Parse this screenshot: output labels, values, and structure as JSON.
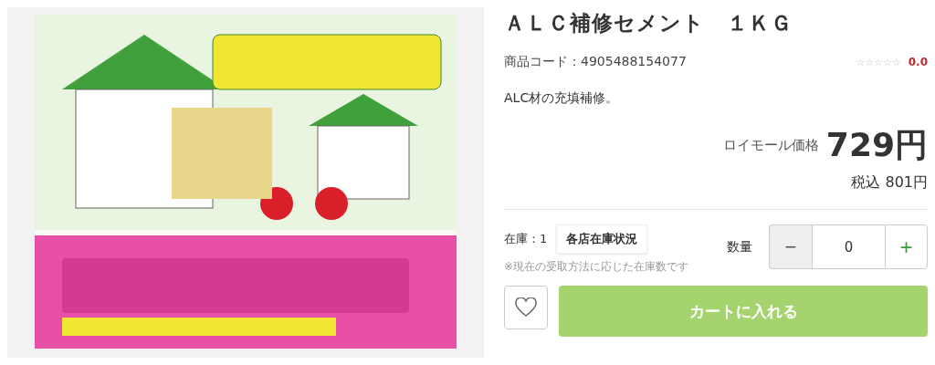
{
  "product": {
    "title": "ＡＬＣ補修セメント　１ＫＧ",
    "code": "商品コード：4905488154077",
    "rating": {
      "stars": 0,
      "score": "0.0"
    },
    "description": "ALC材の充填補修。",
    "price_label": "ロイモール価格",
    "price": "729円",
    "tax_price": "税込 801円",
    "stock": "在庫：1",
    "stock_button": "各店在庫状況",
    "stock_note": "※現在の受取方法に応じた在庫数です",
    "quantity": {
      "label": "数量",
      "minus": "−",
      "value": "0",
      "plus": "+"
    },
    "cart_button": "カートに入れる"
  }
}
